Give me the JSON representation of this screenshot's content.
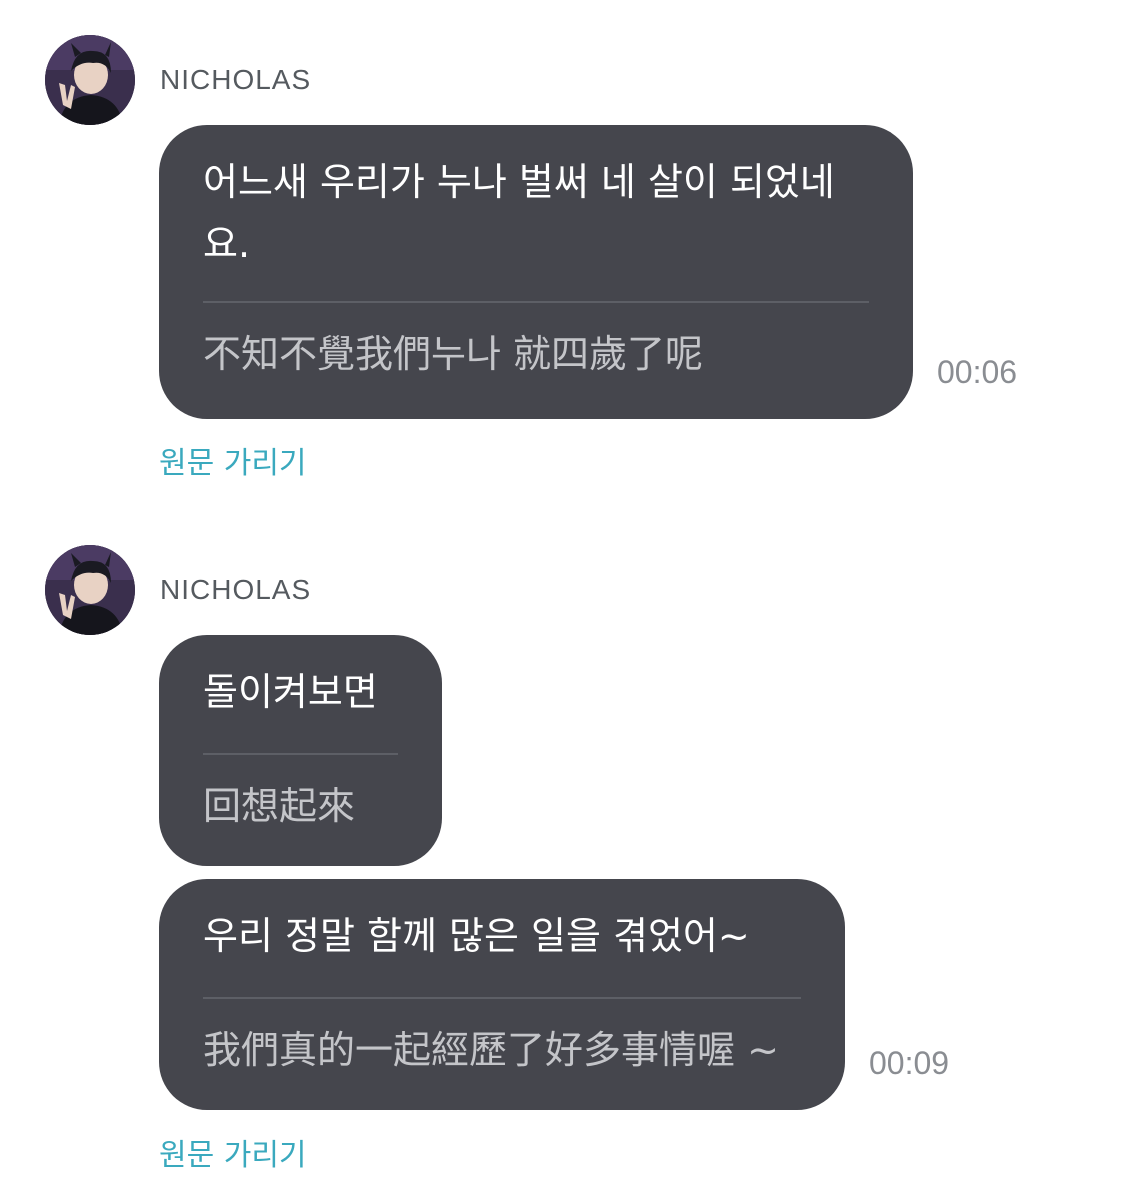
{
  "colors": {
    "bubble": "#45464d",
    "original_text": "#ffffff",
    "translated_text": "#c4c5c9",
    "link": "#3aa9be",
    "timestamp": "#8a8d92"
  },
  "groups": [
    {
      "sender": "NICHOLAS",
      "avatar_icon": "profile-photo",
      "messages": [
        {
          "original": "어느새 우리가 누나  벌써 네 살이 되었네요.",
          "translation": "不知不覺我們누나 就四歲了呢",
          "time": "00:06"
        }
      ],
      "hide_original_label": "원문 가리기"
    },
    {
      "sender": "NICHOLAS",
      "avatar_icon": "profile-photo",
      "messages": [
        {
          "original": "돌이켜보면",
          "translation": "回想起來",
          "time": ""
        },
        {
          "original": "우리 정말 함께 많은 일을 겪었어~",
          "translation": "我們真的一起經歷了好多事情喔 ~",
          "time": "00:09"
        }
      ],
      "hide_original_label": "원문 가리기"
    }
  ]
}
